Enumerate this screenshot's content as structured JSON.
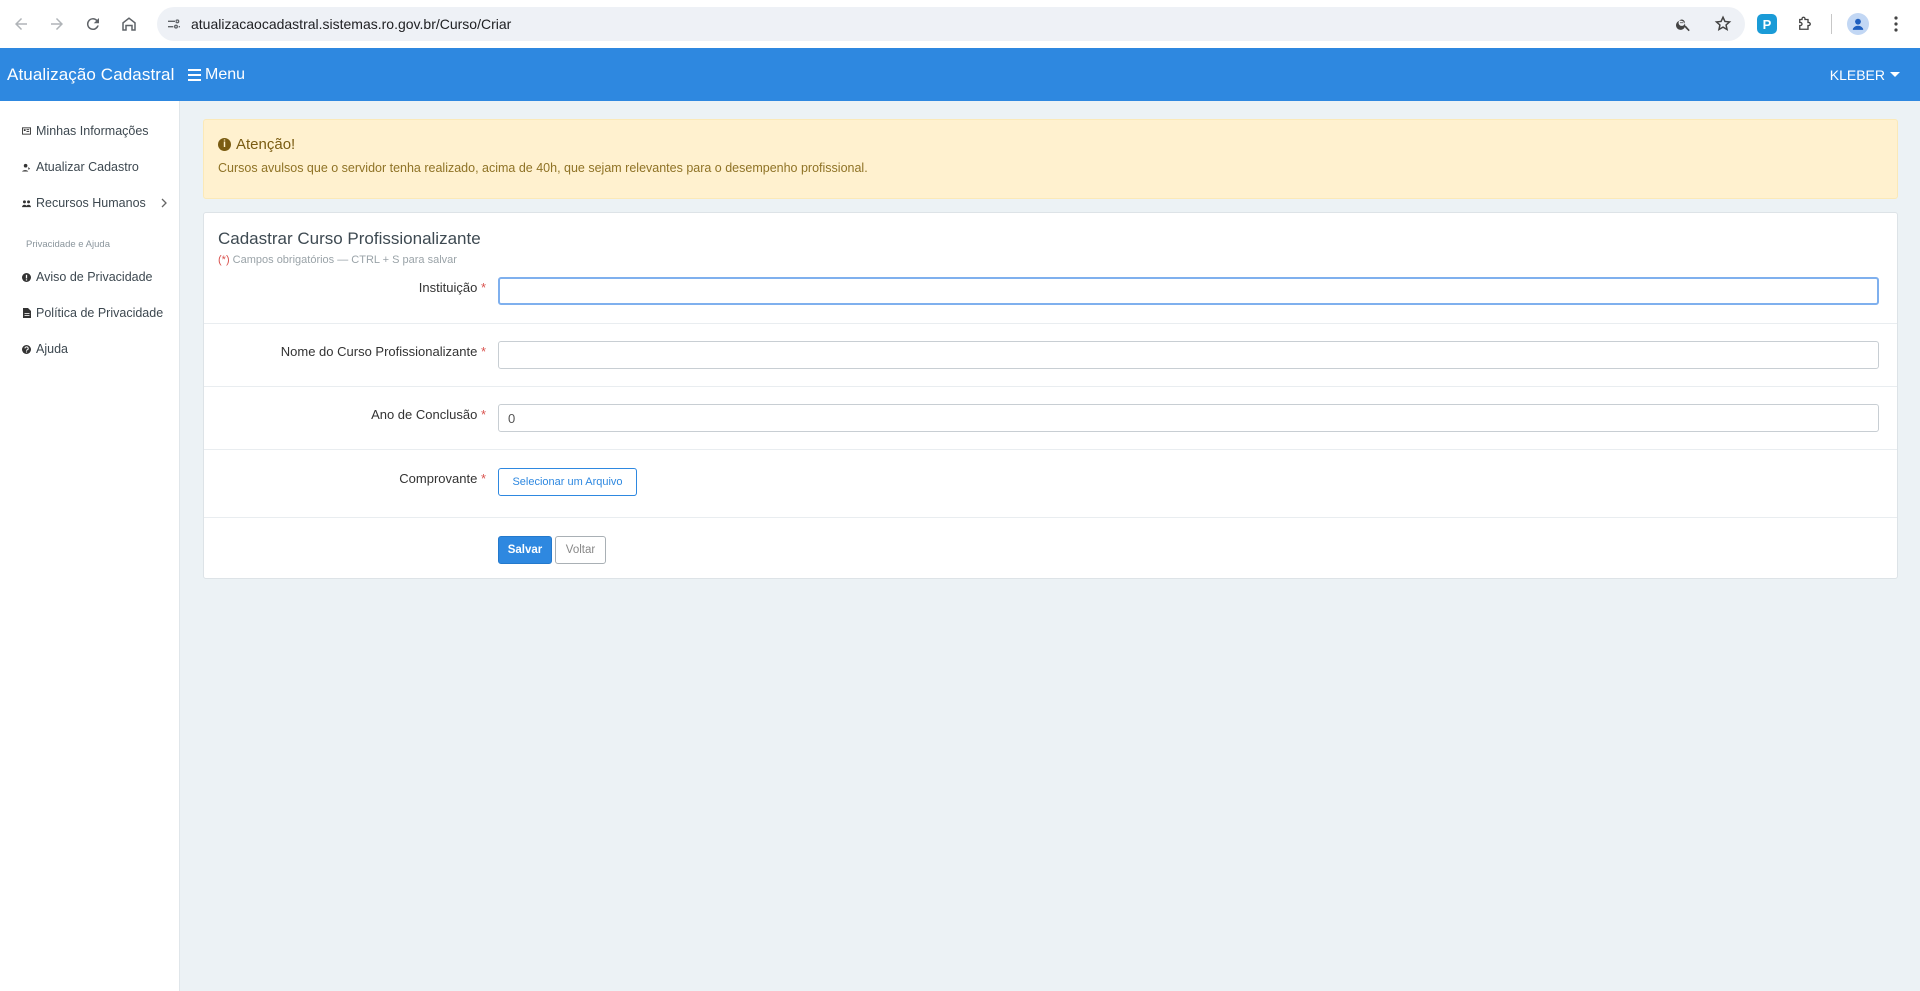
{
  "browser": {
    "url": "atualizacaocadastral.sistemas.ro.gov.br/Curso/Criar",
    "extension_letter": "P"
  },
  "header": {
    "brand": "Atualização Cadastral",
    "menu_label": "Menu",
    "user_label": "KLEBER"
  },
  "sidebar": {
    "items": [
      {
        "label": "Minhas Informações",
        "icon": "id-card-icon"
      },
      {
        "label": "Atualizar Cadastro",
        "icon": "user-edit-icon"
      },
      {
        "label": "Recursos Humanos",
        "icon": "users-icon"
      }
    ],
    "section_heading": "Privacidade e Ajuda",
    "section_items": [
      {
        "label": "Aviso de Privacidade",
        "icon": "exclamation-circle-icon"
      },
      {
        "label": "Política de Privacidade",
        "icon": "file-icon"
      },
      {
        "label": "Ajuda",
        "icon": "question-circle-icon"
      }
    ]
  },
  "alert": {
    "title": "Atenção!",
    "text": "Cursos avulsos que o servidor tenha realizado, acima de 40h, que sejam relevantes para o desempenho profissional."
  },
  "form": {
    "title": "Cadastrar Curso Profissionalizante",
    "required_marker": "(*)",
    "subtitle": "Campos obrigatórios — CTRL + S para salvar",
    "required_star": "*",
    "fields": [
      {
        "label": "Instituição",
        "value": ""
      },
      {
        "label": "Nome do Curso Profissionalizante",
        "value": ""
      },
      {
        "label": "Ano de Conclusão",
        "value": "0"
      },
      {
        "label": "Comprovante"
      }
    ],
    "file_button": "Selecionar um Arquivo",
    "save_button": "Salvar",
    "back_button": "Voltar"
  },
  "colors": {
    "primary": "#2e88e0",
    "alert_bg": "#fff1cf",
    "page_bg": "#ecf2f5",
    "required": "#d9534f"
  }
}
